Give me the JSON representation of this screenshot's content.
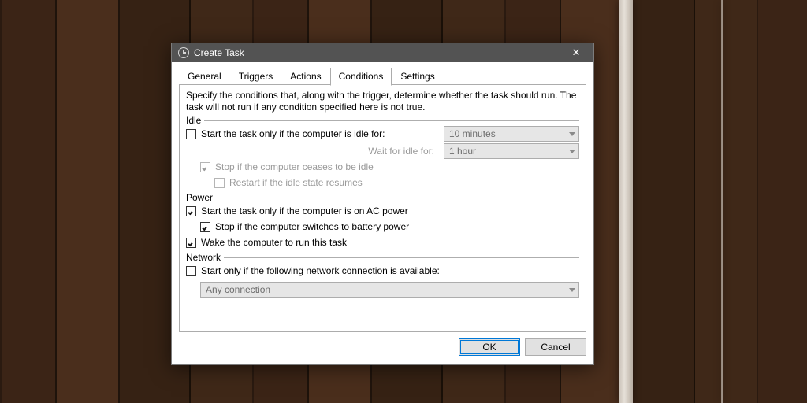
{
  "window": {
    "title": "Create Task"
  },
  "tabs": {
    "items": [
      "General",
      "Triggers",
      "Actions",
      "Conditions",
      "Settings"
    ],
    "active_index": 3
  },
  "conditions": {
    "description": "Specify the conditions that, along with the trigger, determine whether the task should run.  The task will not run  if any condition specified here is not true.",
    "idle": {
      "label": "Idle",
      "start_only_if_idle": {
        "label": "Start the task only if the computer is idle for:",
        "checked": false,
        "duration": "10 minutes"
      },
      "wait_for_idle": {
        "label": "Wait for idle for:",
        "duration": "1 hour"
      },
      "stop_if_not_idle": {
        "label": "Stop if the computer ceases to be idle",
        "checked": true
      },
      "restart_if_idle_resumes": {
        "label": "Restart if the idle state resumes",
        "checked": false
      }
    },
    "power": {
      "label": "Power",
      "start_on_ac": {
        "label": "Start the task only if the computer is on AC power",
        "checked": true
      },
      "stop_on_battery": {
        "label": "Stop if the computer switches to battery power",
        "checked": true
      },
      "wake_to_run": {
        "label": "Wake the computer to run this task",
        "checked": true
      }
    },
    "network": {
      "label": "Network",
      "start_only_if_network": {
        "label": "Start only if the following network connection is available:",
        "checked": false
      },
      "connection": "Any connection"
    }
  },
  "buttons": {
    "ok": "OK",
    "cancel": "Cancel"
  }
}
